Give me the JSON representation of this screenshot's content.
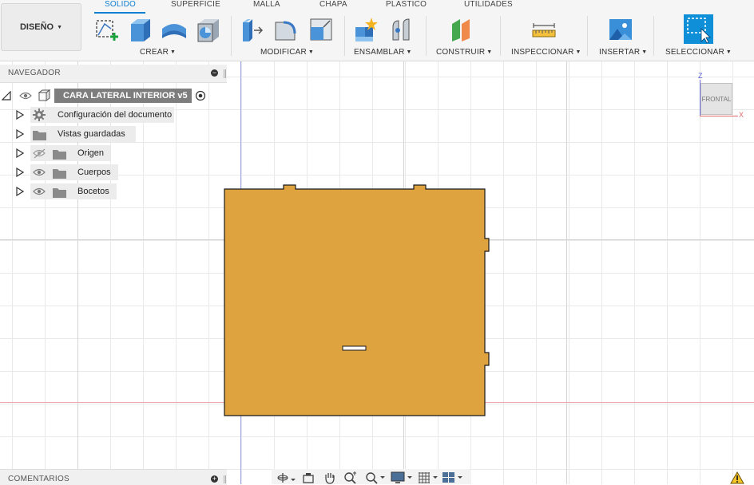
{
  "workspace": {
    "label": "DISEÑO"
  },
  "tabs": [
    {
      "label": "SOLIDO",
      "active": true
    },
    {
      "label": "SUPERFICIE",
      "active": false
    },
    {
      "label": "MALLA",
      "active": false
    },
    {
      "label": "CHAPA",
      "active": false
    },
    {
      "label": "PLASTICO",
      "active": false
    },
    {
      "label": "UTILIDADES",
      "active": false
    }
  ],
  "groups": {
    "crear": "CREAR",
    "modificar": "MODIFICAR",
    "ensamblar": "ENSAMBLAR",
    "construir": "CONSTRUIR",
    "inspeccionar": "INSPECCIONAR",
    "insertar": "INSERTAR",
    "seleccionar": "SELECCIONAR"
  },
  "tools": {
    "create_sketch": "create-sketch-icon",
    "extrude": "extrude-icon",
    "revolve": "revolve-icon",
    "shell": "shell-icon",
    "press_pull": "press-pull-icon",
    "fillet": "fillet-icon",
    "scale": "scale-icon",
    "new_component": "new-component-icon",
    "joint": "joint-icon",
    "offset_plane": "offset-plane-icon",
    "measure": "measure-icon",
    "insert_image": "insert-image-icon",
    "select": "select-icon"
  },
  "browser": {
    "title": "NAVEGADOR",
    "root": "CARA LATERAL INTERIOR v5",
    "items": [
      {
        "label": "Configuración del documento",
        "icon": "gear-icon"
      },
      {
        "label": "Vistas guardadas",
        "icon": "folder-icon"
      },
      {
        "label": "Origen",
        "icon": "folder-icon",
        "visible": false
      },
      {
        "label": "Cuerpos",
        "icon": "folder-icon",
        "visible": true
      },
      {
        "label": "Bocetos",
        "icon": "folder-icon",
        "visible": true
      }
    ]
  },
  "viewcube": {
    "face": "FRONTAL",
    "axis_z": "Z",
    "axis_x": "X"
  },
  "comments": {
    "label": "COMENTARIOS"
  },
  "colors": {
    "accent": "#0f7fd1",
    "body_fill": "#dea33f",
    "body_stroke": "#1a1a1a",
    "x_axis": "#e8a0a8",
    "z_axis": "#7878e0",
    "select_tool": "#0f8fd8"
  }
}
